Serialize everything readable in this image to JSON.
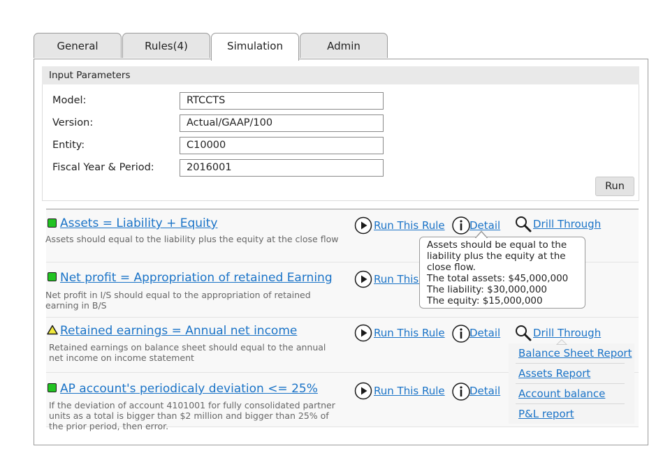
{
  "tabs": [
    {
      "label": "General"
    },
    {
      "label": "Rules(4)"
    },
    {
      "label": "Simulation"
    },
    {
      "label": "Admin"
    }
  ],
  "params": {
    "header": "Input Parameters",
    "fields": [
      {
        "label": "Model:",
        "value": "RTCCTS"
      },
      {
        "label": "Version:",
        "value": "Actual/GAAP/100"
      },
      {
        "label": "Entity:",
        "value": "C10000"
      },
      {
        "label": "Fiscal Year & Period:",
        "value": "2016001"
      }
    ],
    "run_label": "Run"
  },
  "actions": {
    "run_rule": "Run This Rule",
    "detail": "Detail",
    "drill": "Drill Through"
  },
  "rules": [
    {
      "title": "Assets = Liability + Equity",
      "status": "ok",
      "desc": "Assets should equal to the liability plus the equity at the close flow"
    },
    {
      "title": "Net profit = Appropriation of retained Earning",
      "status": "ok",
      "desc": "Net profit in I/S should equal to the appropriation of retained earning in B/S"
    },
    {
      "title": "Retained earnings = Annual net income",
      "status": "warning",
      "desc": "Retained earnings on balance sheet should equal to the annual net income on income statement"
    },
    {
      "title": "AP account's periodicaly deviation <= 25%",
      "status": "ok",
      "desc": "If the deviation of account 4101001 for fully consolidated partner units as a total is bigger than $2 million and bigger than 25% of the prior period, then error."
    }
  ],
  "tooltip": {
    "lines": [
      "Assets should be equal to the",
      "liability plus the equity at the",
      "close flow.",
      "The total assets: $45,000,000",
      "The liability: $30,000,000",
      "The equity: $15,000,000"
    ]
  },
  "drill_menu": {
    "items": [
      "Balance Sheet Report",
      "Assets Report",
      "Account balance",
      "P&L report"
    ]
  },
  "colors": {
    "link": "#1a73c7",
    "ok": "#22c322",
    "warning": "#f2ea3c"
  }
}
